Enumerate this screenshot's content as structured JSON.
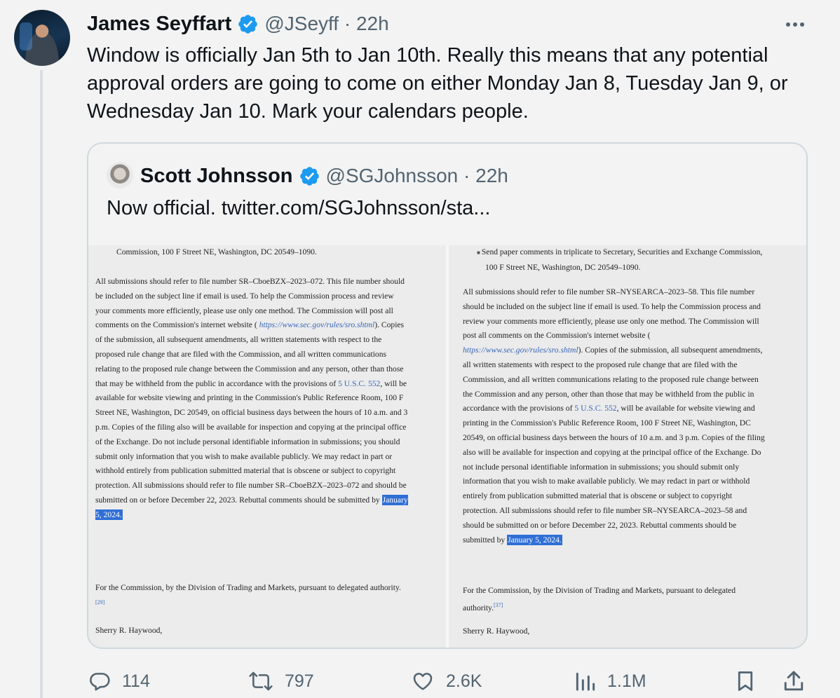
{
  "tweet": {
    "author_name": "James Seyffart",
    "author_handle_time": "@JSeyff · 22h",
    "text": "Window is officially Jan 5th to Jan 10th. Really this means that any potential approval orders are going to come on either Monday Jan 8, Tuesday Jan 9, or Wednesday Jan 10. Mark your calendars people."
  },
  "quote": {
    "author_name": "Scott Johnsson",
    "author_handle_time": "@SGJohnsson · 22h",
    "text": "Now official.  twitter.com/SGJohnsson/sta..."
  },
  "doc_left": {
    "top_line": "Commission, 100 F Street NE, Washington, DC 20549–1090.",
    "p1_a": "All submissions should refer to file number SR–CboeBZX–2023–072. This file number should be included on the subject line if email is used. To help the Commission process and review your comments more efficiently, please use only one method. The Commission will post all comments on the Commission's internet website ( ",
    "p1_link1": "https://www.sec.gov/rules/sro.shtml",
    "p1_b": "). Copies of the submission, all subsequent amendments, all written statements with respect to the proposed rule change that are filed with the Commission, and all written communications relating to the proposed rule change between the Commission and any person, other than those that may be withheld from the public in accordance with the provisions of ",
    "p1_link2": "5 U.S.C. 552",
    "p1_c": ", will be available for website viewing and printing in the Commission's Public Reference Room, 100 F Street NE, Washington, DC 20549, on official business days between the hours of 10 a.m. and 3 p.m. Copies of the filing also will be available for inspection and copying at the principal office of the Exchange. Do not include personal identifiable information in submissions; you should submit only information that you wish to make available publicly. We may redact in part or withhold entirely from publication submitted material that is obscene or subject to copyright protection. All submissions should refer to file number SR–CboeBZX–2023–072 and should be submitted on or before December 22, 2023. Rebuttal comments should be submitted by ",
    "p1_highlight": "January 5, 2024.",
    "p2": "For the Commission, by the Division of Trading and Markets, pursuant to delegated authority.",
    "p2_footnote": "[29]",
    "signer": "Sherry R. Haywood,"
  },
  "doc_right": {
    "bullet": "Send paper comments in triplicate to Secretary, Securities and Exchange Commission, 100 F Street NE, Washington, DC 20549–1090.",
    "p1_a": "All submissions should refer to file number SR–NYSEARCA–2023–58. This file number should be included on the subject line if email is used. To help the Commission process and review your comments more efficiently, please use only one method. The Commission will post all comments on the Commission's internet website ( ",
    "p1_link1": "https://www.sec.gov/rules/sro.shtml",
    "p1_b": "). Copies of the submission, all subsequent amendments, all written statements with respect to the proposed rule change that are filed with the Commission, and all written communications relating to the proposed rule change between the Commission and any person, other than those that may be withheld from the public in accordance with the provisions of ",
    "p1_link2": "5 U.S.C. 552",
    "p1_c": ", will be available for website viewing and printing in the Commission's Public Reference Room, 100 F Street NE, Washington, DC 20549, on official business days between the hours of 10 a.m. and 3 p.m. Copies of the filing also will be available for inspection and copying at the principal office of the Exchange. Do not include personal identifiable information in submissions; you should submit only information that you wish to make available publicly. We may redact in part or withhold entirely from publication submitted material that is obscene or subject to copyright protection. All submissions should refer to file number SR–NYSEARCA–2023–58 and should be submitted on or before December 22, 2023. Rebuttal comments should be submitted by ",
    "p1_highlight": "January 5, 2024.",
    "p2": "For the Commission, by the Division of Trading and Markets, pursuant to delegated authority.",
    "p2_footnote": "[37]",
    "signer": "Sherry R. Haywood,"
  },
  "actions": {
    "replies": "114",
    "retweets": "797",
    "likes": "2.6K",
    "views": "1.1M"
  },
  "colors": {
    "verified": "#1d9bf0",
    "highlight": "#2f6fd6",
    "link": "#3a66b8",
    "secondary_text": "#536471"
  }
}
